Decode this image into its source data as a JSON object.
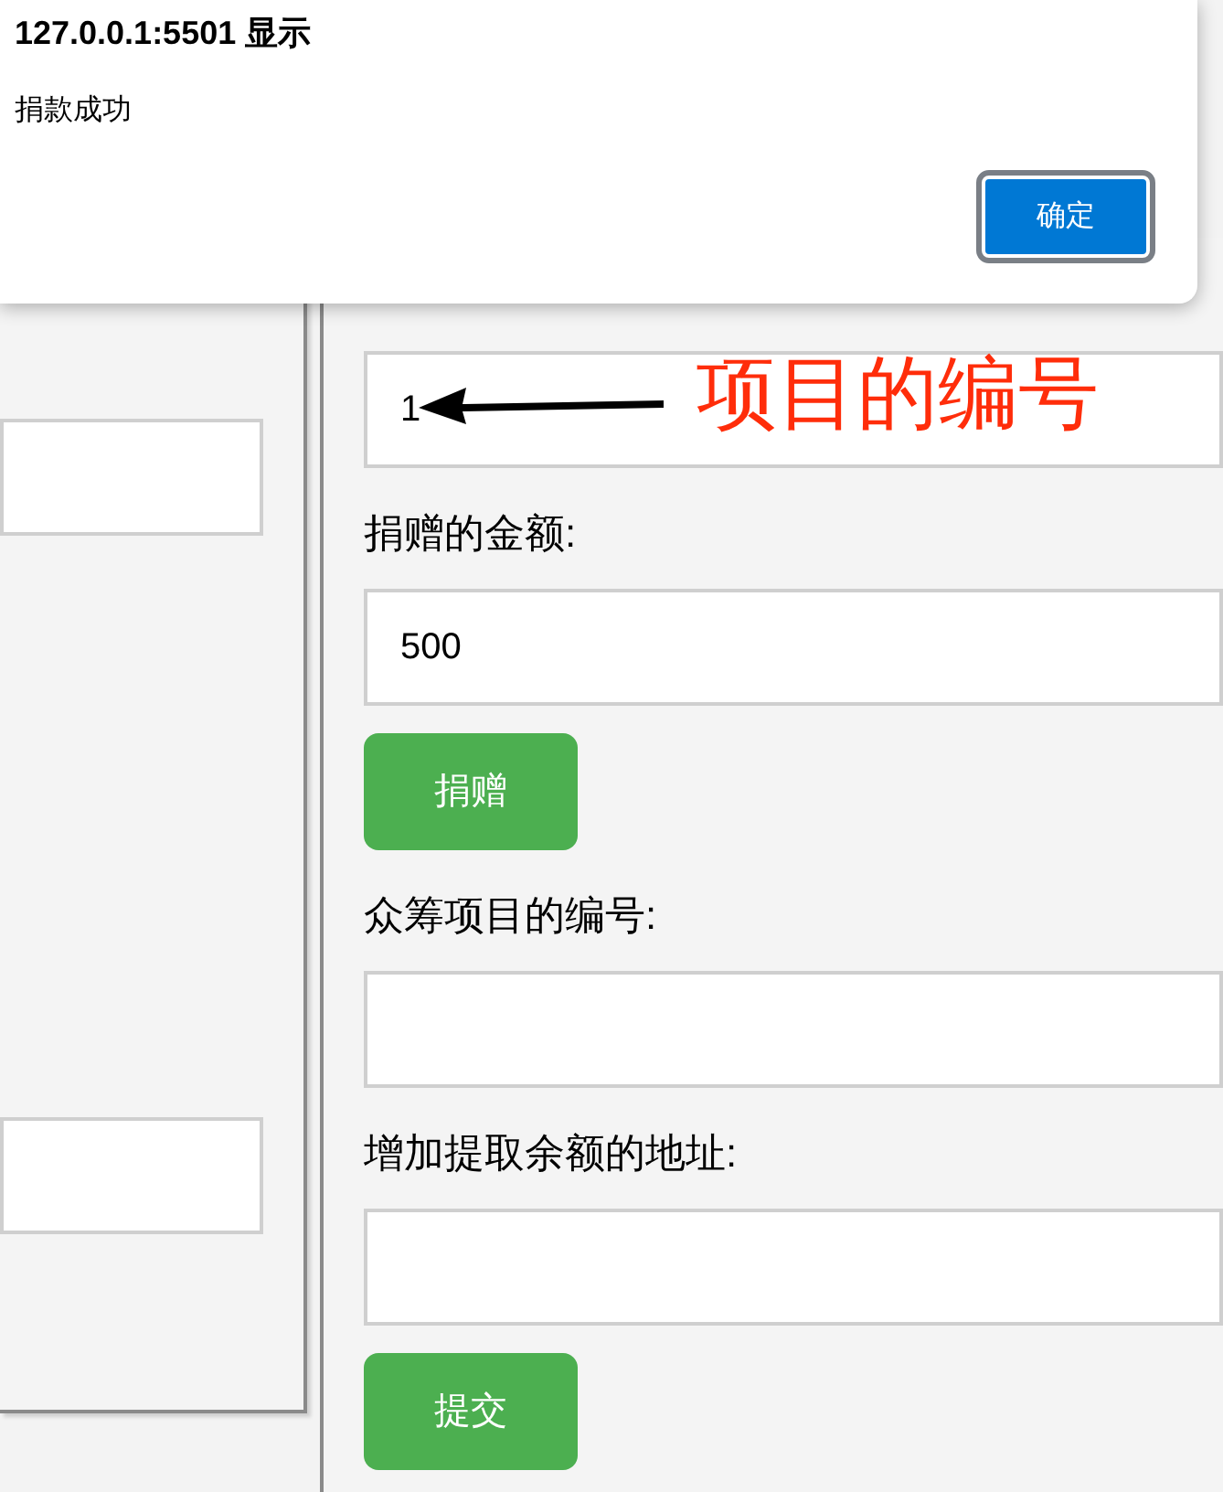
{
  "dialog": {
    "title": "127.0.0.1:5501 显示",
    "message": "捐款成功",
    "button": "确定"
  },
  "left_panel": {
    "fields": [
      {
        "kind": "input"
      },
      {
        "kind": "input"
      }
    ]
  },
  "form": [
    {
      "kind": "field",
      "value": "1"
    },
    {
      "kind": "label",
      "text": "捐赠的金额:"
    },
    {
      "kind": "field",
      "value": "500"
    },
    {
      "kind": "button",
      "label": "捐赠"
    },
    {
      "kind": "label",
      "text": "众筹项目的编号:"
    },
    {
      "kind": "field"
    },
    {
      "kind": "label",
      "text": "增加提取余额的地址:"
    },
    {
      "kind": "field"
    },
    {
      "kind": "button",
      "label": "提交"
    }
  ],
  "annotation": {
    "text": "项目的编号"
  }
}
